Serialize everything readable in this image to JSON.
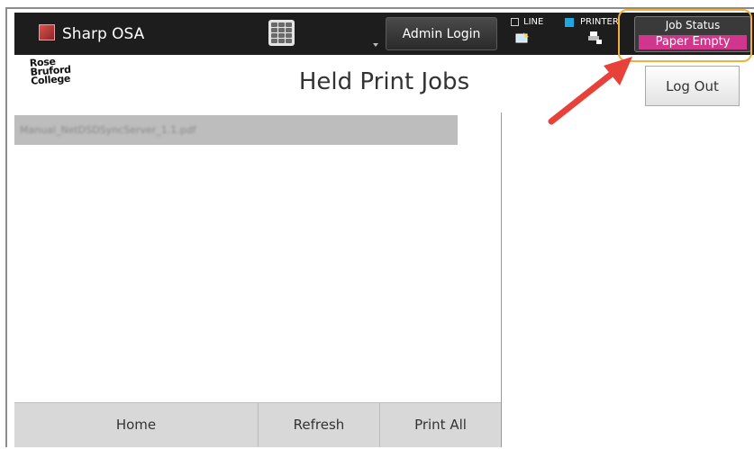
{
  "app": {
    "title": "Sharp OSA"
  },
  "topbar": {
    "admin_login_label": "Admin Login",
    "line_label": "LINE",
    "printer_label": "PRINTER",
    "job_status_label": "Job Status",
    "job_status_value": "Paper Empty",
    "icons": [
      "app-icon",
      "keypad-icon",
      "line-fax-icon",
      "printer-tray-icon"
    ]
  },
  "logo": {
    "lines": [
      "Rose",
      "Bruford",
      "College"
    ]
  },
  "main": {
    "page_title": "Held Print Jobs",
    "logout_label": "Log Out",
    "jobs": [
      {
        "name": "Manual_NetDSDSyncServer_1.1.pdf"
      }
    ]
  },
  "footer": {
    "home_label": "Home",
    "refresh_label": "Refresh",
    "print_all_label": "Print All"
  },
  "colors": {
    "paper_empty_bg": "#d0378c",
    "highlight_ring": "#f1b03b",
    "arrow": "#e8413a",
    "printer_indicator": "#1fa8e0"
  }
}
